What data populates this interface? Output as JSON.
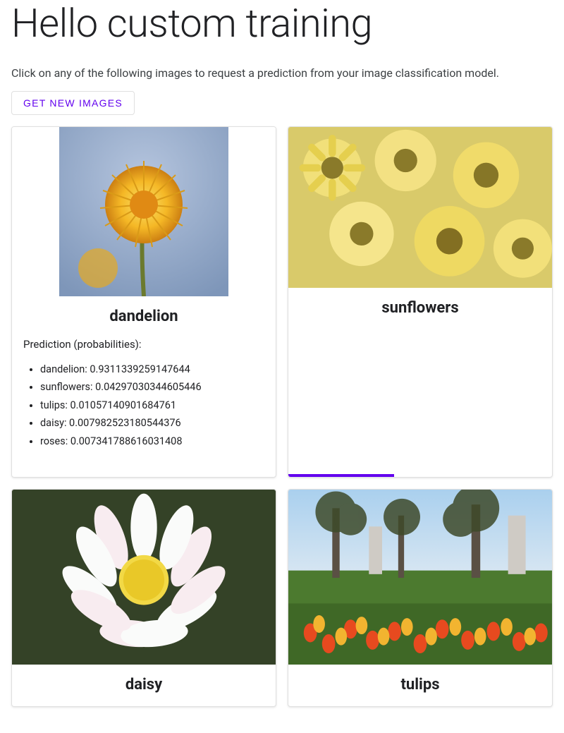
{
  "title": "Hello custom training",
  "instructions": "Click on any of the following images to request a prediction from your image classification model.",
  "getNewImagesLabel": "GET NEW IMAGES",
  "cards": [
    {
      "label": "dandelion",
      "prediction": {
        "heading": "Prediction (probabilities):",
        "items": [
          {
            "class": "dandelion",
            "prob": 0.9311339259147644
          },
          {
            "class": "sunflowers",
            "prob": 0.04297030344605446
          },
          {
            "class": "tulips",
            "prob": 0.01057140901684761
          },
          {
            "class": "daisy",
            "prob": 0.007982523180544376
          },
          {
            "class": "roses",
            "prob": 0.007341788616031408
          }
        ]
      }
    },
    {
      "label": "sunflowers",
      "loading": true,
      "progressPercent": 40
    },
    {
      "label": "daisy"
    },
    {
      "label": "tulips"
    }
  ],
  "colors": {
    "accent": "#6200ee"
  }
}
